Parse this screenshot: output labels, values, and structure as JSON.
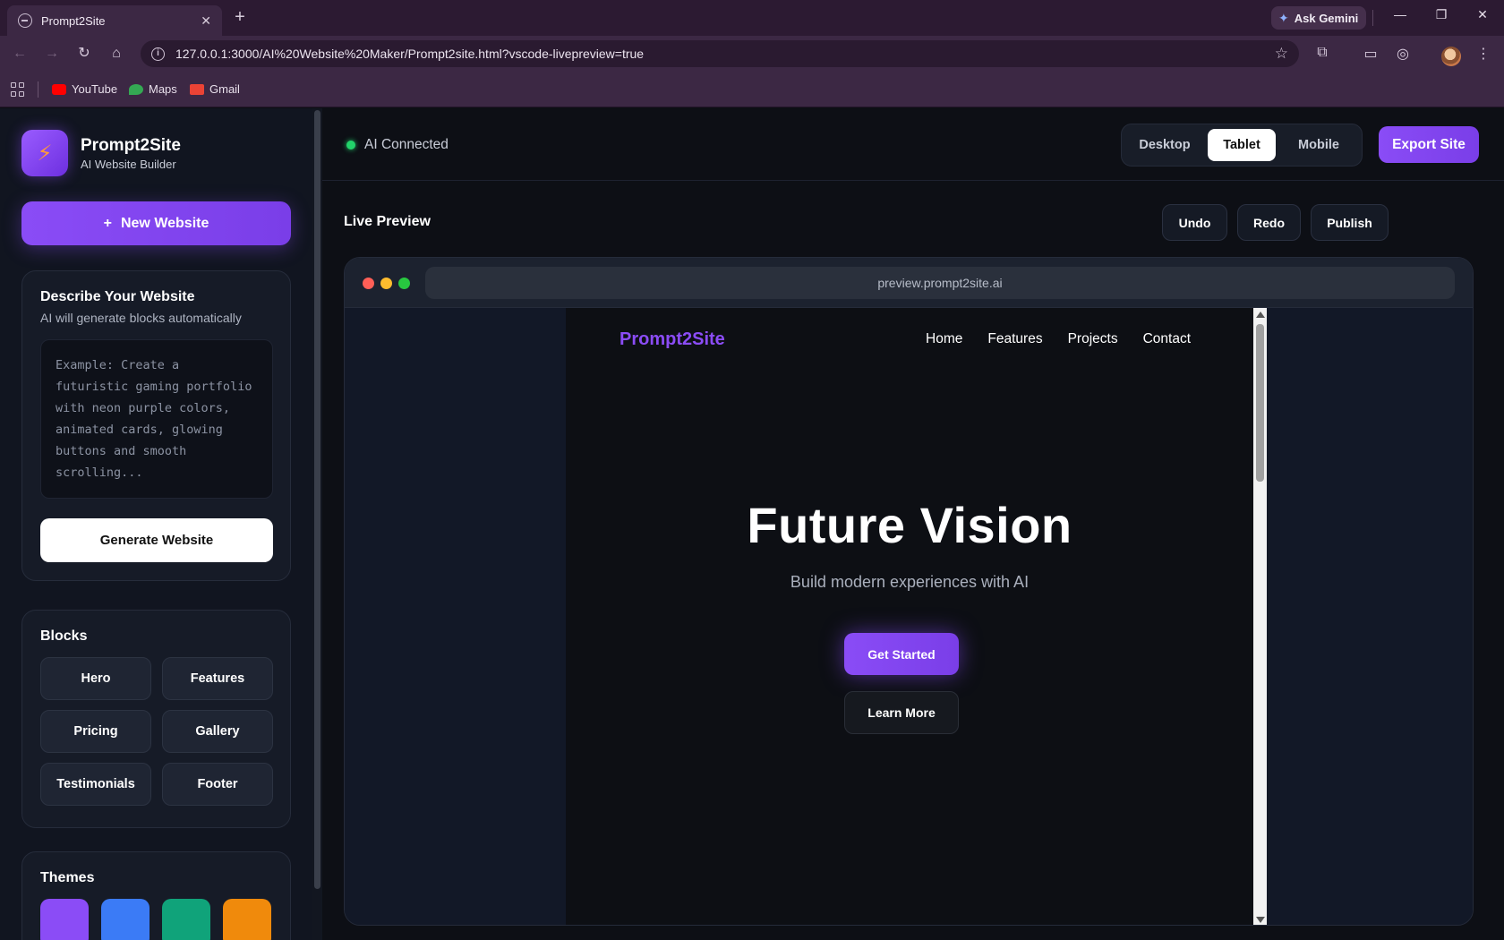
{
  "browser": {
    "tab_title": "Prompt2Site",
    "url": "127.0.0.1:3000/AI%20Website%20Maker/Prompt2site.html?vscode-livepreview=true",
    "gemini_label": "Ask Gemini",
    "bookmarks": [
      {
        "label": "YouTube",
        "color": "#ff0000"
      },
      {
        "label": "Maps",
        "color": "#34a853"
      },
      {
        "label": "Gmail",
        "color": "#ea4335"
      }
    ]
  },
  "sidebar": {
    "brand_name": "Prompt2Site",
    "brand_sub": "AI Website Builder",
    "new_button": "New Website",
    "new_button_icon": "+",
    "describe": {
      "title": "Describe Your Website",
      "hint": "AI will generate blocks automatically",
      "placeholder": "Example: Create a futuristic gaming portfolio with neon purple colors, animated cards, glowing buttons and smooth scrolling...",
      "generate_button": "Generate Website"
    },
    "blocks": {
      "title": "Blocks",
      "items": [
        "Hero",
        "Features",
        "Pricing",
        "Gallery",
        "Testimonials",
        "Footer"
      ]
    },
    "themes": {
      "title": "Themes",
      "colors": [
        "#8b4cf6",
        "#3b7bf6",
        "#10a37a",
        "#f08a0c"
      ]
    }
  },
  "topbar": {
    "status": "AI Connected",
    "devices": [
      "Desktop",
      "Tablet",
      "Mobile"
    ],
    "active_device": "Tablet",
    "export_button": "Export Site"
  },
  "preview": {
    "title": "Live Preview",
    "undo": "Undo",
    "redo": "Redo",
    "publish": "Publish",
    "frame_url": "preview.prompt2site.ai"
  },
  "site": {
    "logo": "Prompt2Site",
    "nav": [
      "Home",
      "Features",
      "Projects",
      "Contact"
    ],
    "hero_title": "Future Vision",
    "hero_sub": "Build modern experiences with AI",
    "primary_cta": "Get Started",
    "secondary_cta": "Learn More"
  },
  "colors": {
    "accent": "#8b4cf6",
    "status_ok": "#22d36a"
  }
}
